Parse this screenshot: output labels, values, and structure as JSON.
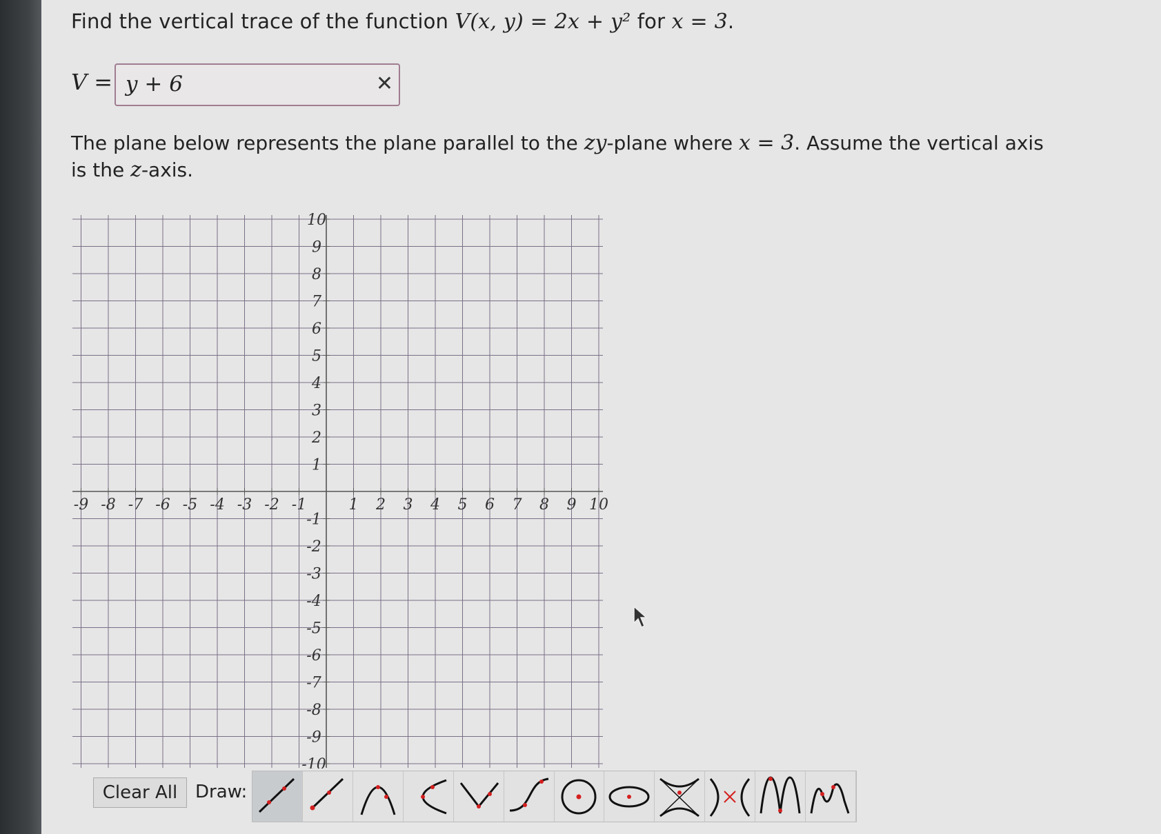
{
  "question": {
    "prefix": "Find the vertical trace of the function ",
    "function_expr": "V(x, y) = 2x + y²",
    "middle": " for ",
    "condition": "x = 3",
    "suffix": "."
  },
  "answer": {
    "label": "V =",
    "value": "y + 6",
    "clear_icon": "✕"
  },
  "description": {
    "part1": "The plane below represents the plane parallel to the ",
    "plane_var": "zy",
    "part2": "-plane where ",
    "condition": "x = 3",
    "part3": ". Assume the vertical axis is the ",
    "axis_var": "z",
    "part4": "-axis."
  },
  "graph": {
    "x_min": -10,
    "x_max": 10,
    "y_min": -10,
    "y_max": 10,
    "x_tick_labels": [
      "10",
      "-9",
      "-8",
      "-7",
      "-6",
      "-5",
      "-4",
      "-3",
      "-2",
      "-1",
      "1",
      "2",
      "3",
      "4",
      "5",
      "6",
      "7",
      "8",
      "9",
      "10"
    ],
    "y_tick_labels_pos": [
      "10",
      "9",
      "8",
      "7",
      "6",
      "5",
      "4",
      "3",
      "2",
      "1"
    ],
    "y_tick_labels_neg": [
      "-1",
      "-2",
      "-3",
      "-4",
      "-5",
      "-6",
      "-7",
      "-8",
      "-9",
      "-10"
    ],
    "grid_color": "#7a6f86",
    "axis_color": "#555555"
  },
  "toolbar": {
    "clear_label": "Clear All",
    "draw_label": "Draw:",
    "tools": [
      {
        "icon": "line-icon",
        "active": true
      },
      {
        "icon": "ray-icon",
        "active": false
      },
      {
        "icon": "parabola-down-icon",
        "active": false
      },
      {
        "icon": "parabola-left-icon",
        "active": false
      },
      {
        "icon": "absolute-value-icon",
        "active": false
      },
      {
        "icon": "cubic-curve-icon",
        "active": false
      },
      {
        "icon": "circle-icon",
        "active": false
      },
      {
        "icon": "ellipse-icon",
        "active": false
      },
      {
        "icon": "hyperbola-vertical-icon",
        "active": false
      },
      {
        "icon": "hyperbola-horizontal-icon",
        "active": false
      },
      {
        "icon": "sine-wave-icon",
        "active": false
      },
      {
        "icon": "cosine-wave-icon",
        "active": false
      }
    ]
  },
  "colors": {
    "accent_red": "#d41f1f",
    "answer_border": "#a07c90"
  }
}
